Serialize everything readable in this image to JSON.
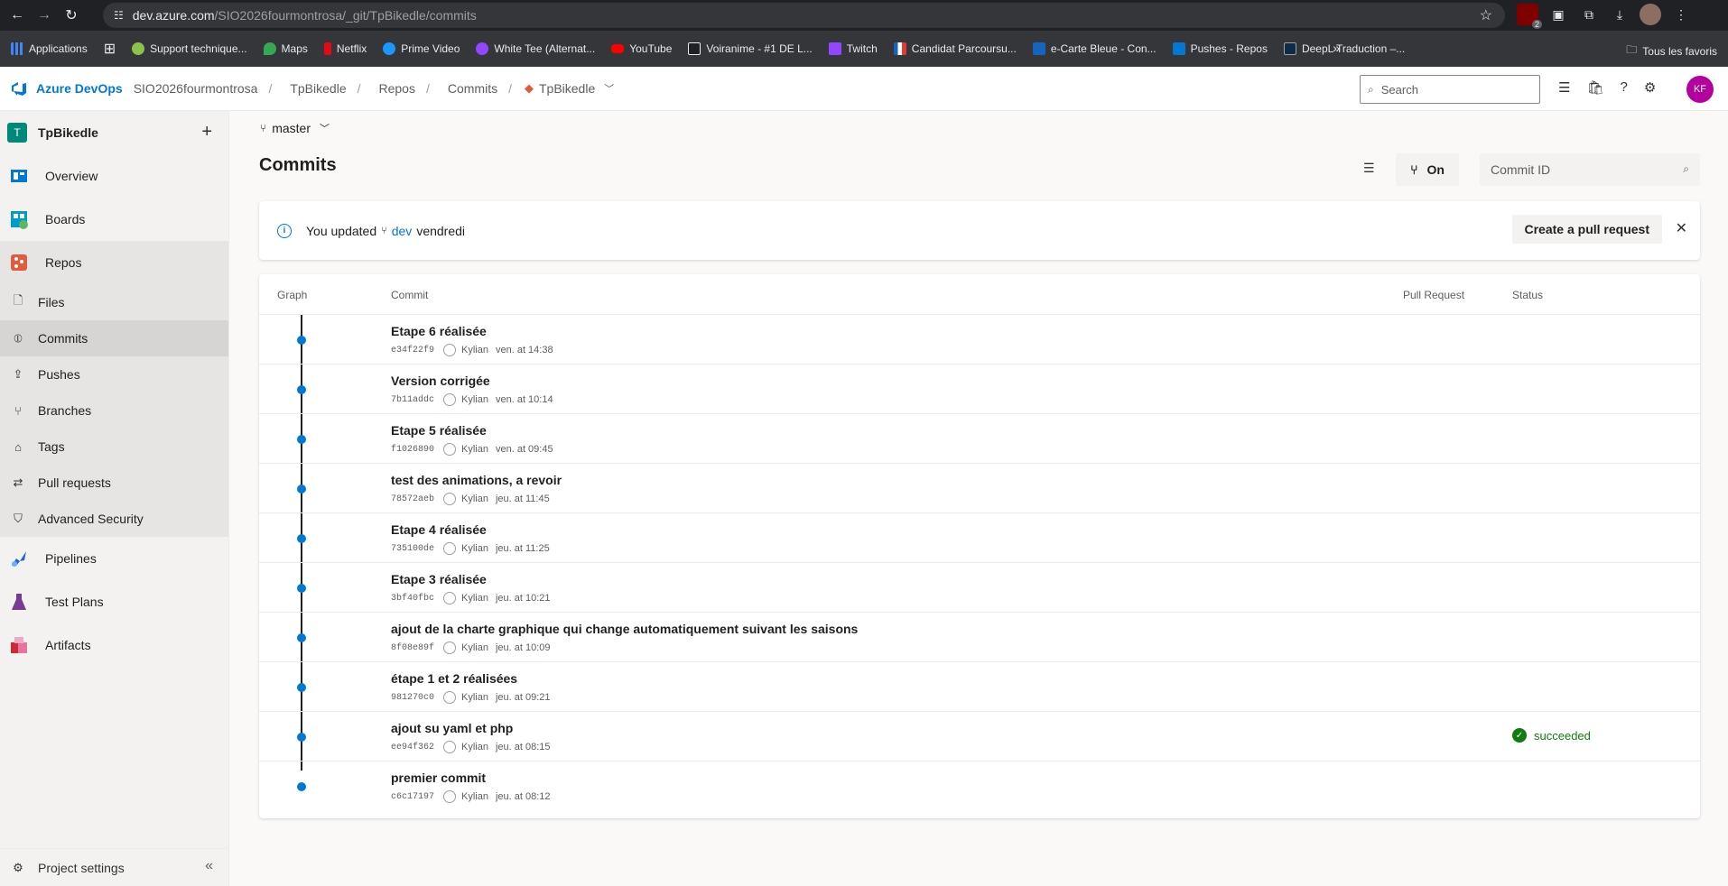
{
  "browser": {
    "url_host": "dev.azure.com",
    "url_path": "/SIO2026fourmontrosa/_git/TpBikedle/commits",
    "ext_badge": "2"
  },
  "bookmarks": {
    "items": [
      {
        "label": "Applications",
        "color": "#4285f4"
      },
      {
        "label": "Support technique...",
        "color": "#8bc34a"
      },
      {
        "label": "Maps",
        "color": "#34a853"
      },
      {
        "label": "Netflix",
        "color": "#e50914"
      },
      {
        "label": "Prime Video",
        "color": "#1a98ff"
      },
      {
        "label": "White Tee (Alternat...",
        "color": "#9146ff"
      },
      {
        "label": "YouTube",
        "color": "#ff0000"
      },
      {
        "label": "Voiranime - #1 DE L...",
        "color": "#e8eaed"
      },
      {
        "label": "Twitch",
        "color": "#9146ff"
      },
      {
        "label": "Candidat Parcoursu...",
        "color": "#e53935"
      },
      {
        "label": "e-Carte Bleue - Con...",
        "color": "#1565c0"
      },
      {
        "label": "Pushes - Repos",
        "color": "#0078d4"
      },
      {
        "label": "DeepL Traduction –...",
        "color": "#0f2b46"
      }
    ],
    "more": "»",
    "all": "Tous les favoris"
  },
  "header": {
    "brand": "Azure DevOps",
    "org": "SIO2026fourmontrosa",
    "project": "TpBikedle",
    "section": "Repos",
    "page": "Commits",
    "repo": "TpBikedle",
    "search_placeholder": "Search",
    "avatar": "KF",
    "sep": "/"
  },
  "sidebar": {
    "project_badge": "T",
    "project_name": "TpBikedle",
    "items": [
      {
        "label": "Overview"
      },
      {
        "label": "Boards"
      },
      {
        "label": "Repos"
      },
      {
        "label": "Pipelines"
      },
      {
        "label": "Test Plans"
      },
      {
        "label": "Artifacts"
      }
    ],
    "sub": [
      {
        "label": "Files"
      },
      {
        "label": "Commits"
      },
      {
        "label": "Pushes"
      },
      {
        "label": "Branches"
      },
      {
        "label": "Tags"
      },
      {
        "label": "Pull requests"
      },
      {
        "label": "Advanced Security"
      }
    ],
    "settings": "Project settings"
  },
  "main": {
    "branch": "master",
    "title": "Commits",
    "graph_toggle": "On",
    "commit_id_placeholder": "Commit ID",
    "banner": {
      "prefix": "You updated",
      "branch": "dev",
      "suffix": "vendredi",
      "pr_button": "Create a pull request"
    },
    "columns": {
      "graph": "Graph",
      "commit": "Commit",
      "pull_request": "Pull Request",
      "status": "Status"
    },
    "commits": [
      {
        "message": "Etape 6 réalisée",
        "hash": "e34f22f9",
        "author": "Kylian",
        "time": "ven. at 14:38",
        "status": ""
      },
      {
        "message": "Version corrigée",
        "hash": "7b11addc",
        "author": "Kylian",
        "time": "ven. at 10:14",
        "status": ""
      },
      {
        "message": "Etape 5 réalisée",
        "hash": "f1026890",
        "author": "Kylian",
        "time": "ven. at 09:45",
        "status": ""
      },
      {
        "message": "test des animations, a revoir",
        "hash": "78572aeb",
        "author": "Kylian",
        "time": "jeu. at 11:45",
        "status": ""
      },
      {
        "message": "Etape 4 réalisée",
        "hash": "735100de",
        "author": "Kylian",
        "time": "jeu. at 11:25",
        "status": ""
      },
      {
        "message": "Etape 3 réalisée",
        "hash": "3bf40fbc",
        "author": "Kylian",
        "time": "jeu. at 10:21",
        "status": ""
      },
      {
        "message": "ajout de la charte graphique qui change automatiquement suivant les saisons",
        "hash": "8f08e89f",
        "author": "Kylian",
        "time": "jeu. at 10:09",
        "status": ""
      },
      {
        "message": "étape 1 et 2 réalisées",
        "hash": "981270c0",
        "author": "Kylian",
        "time": "jeu. at 09:21",
        "status": ""
      },
      {
        "message": "ajout su yaml et php",
        "hash": "ee94f362",
        "author": "Kylian",
        "time": "jeu. at 08:15",
        "status": "succeeded"
      },
      {
        "message": "premier commit",
        "hash": "c6c17197",
        "author": "Kylian",
        "time": "jeu. at 08:12",
        "status": ""
      }
    ]
  }
}
